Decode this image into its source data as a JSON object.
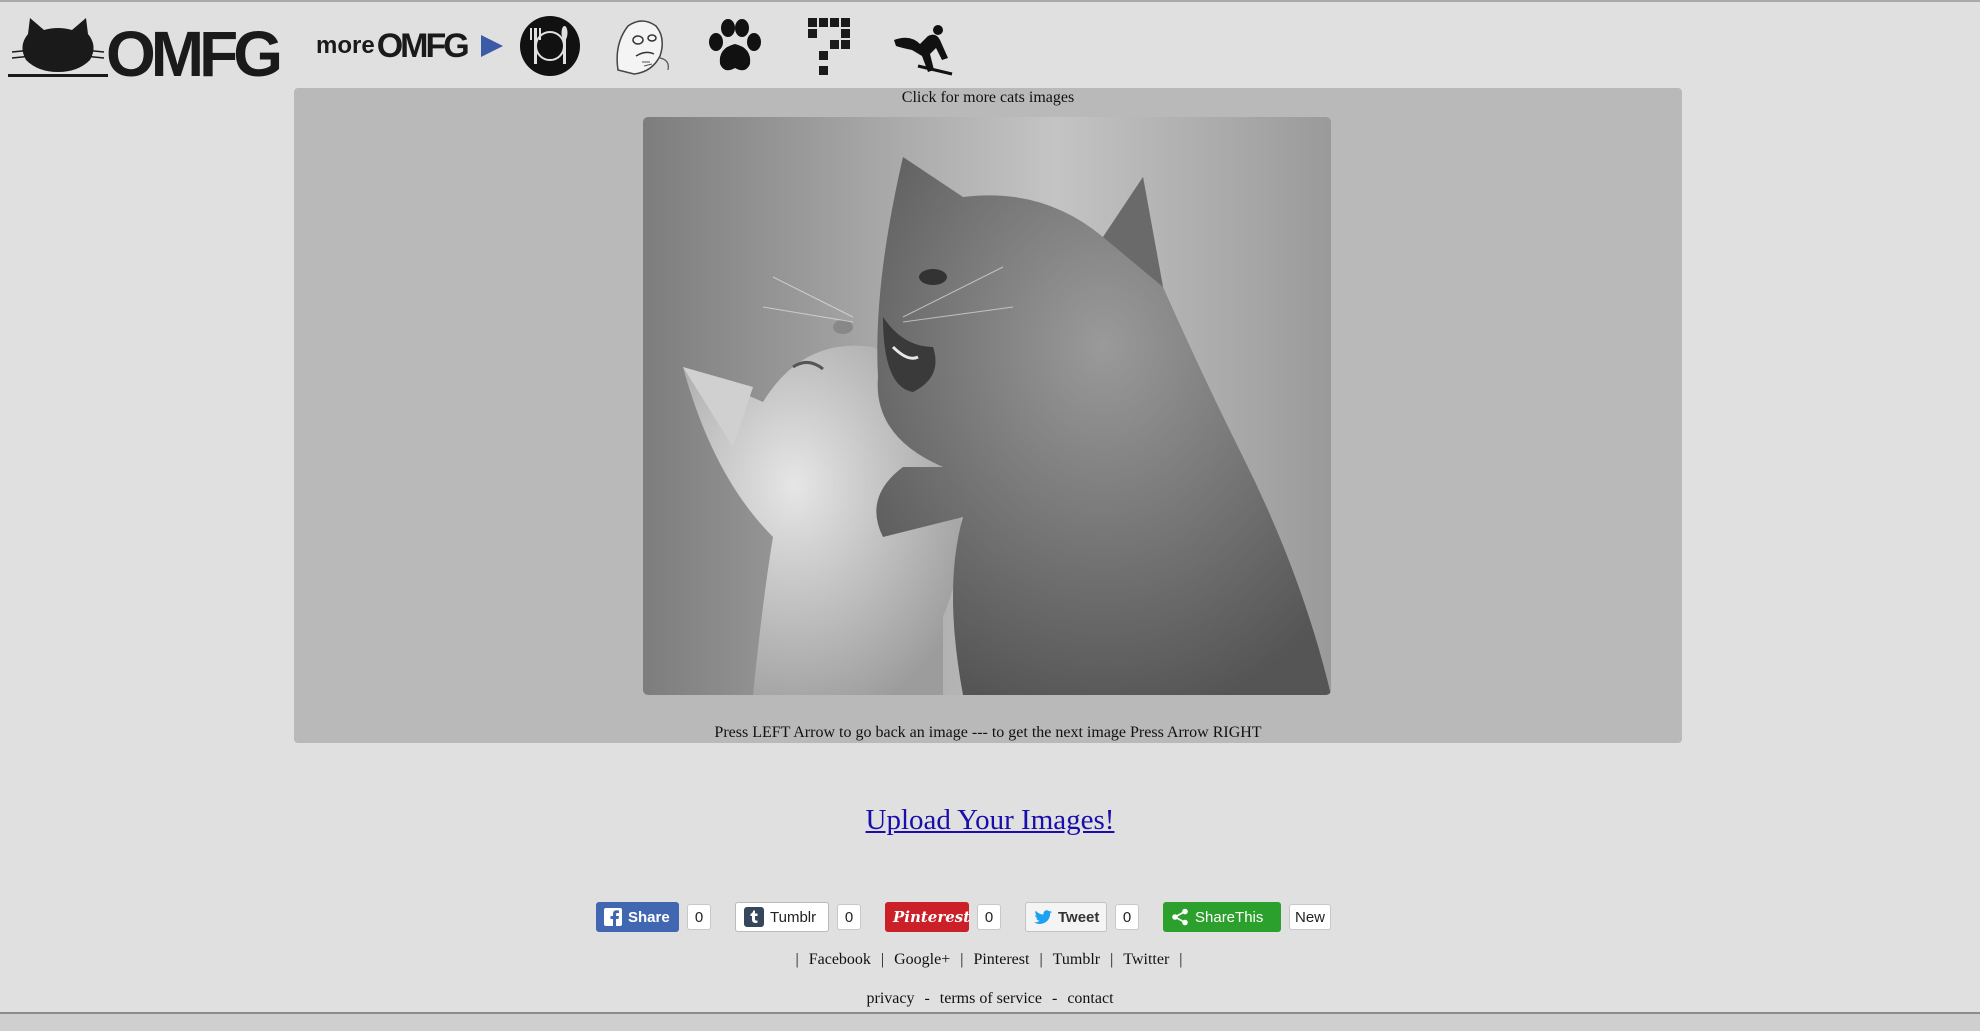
{
  "header": {
    "logo_text": "OMFG",
    "more_prefix": "more",
    "more_brand": "OMFG",
    "nav_icons": [
      "food-icon",
      "meme-face-icon",
      "paw-icon",
      "pixel-question-icon",
      "extreme-sports-icon"
    ]
  },
  "gallery": {
    "caption": "Click for more cats images",
    "image_subject": "kitten-kissing-photo",
    "hint": "Press LEFT Arrow to go back an image --- to get the next image Press Arrow RIGHT"
  },
  "upload": {
    "label": "Upload Your Images!"
  },
  "share": {
    "facebook": {
      "label": "Share",
      "count": "0"
    },
    "tumblr": {
      "label": "Tumblr",
      "count": "0"
    },
    "pinterest": {
      "label": "Pinterest",
      "count": "0"
    },
    "twitter": {
      "label": "Tweet",
      "count": "0"
    },
    "sharethis": {
      "label": "ShareThis",
      "badge": "New"
    }
  },
  "footer": {
    "links": [
      "Facebook",
      "Google+",
      "Pinterest",
      "Tumblr",
      "Twitter"
    ],
    "separator": "|",
    "legal": [
      "privacy",
      "terms of service",
      "contact"
    ],
    "legal_separator": "-"
  },
  "colors": {
    "page_bg": "#e0e0e0",
    "gallery_bg": "#b9b9b9",
    "link": "#1a0dab",
    "more_arrow": "#3b5ba9",
    "facebook": "#4267b2",
    "pinterest": "#cb2027",
    "sharethis": "#2ca02c"
  }
}
